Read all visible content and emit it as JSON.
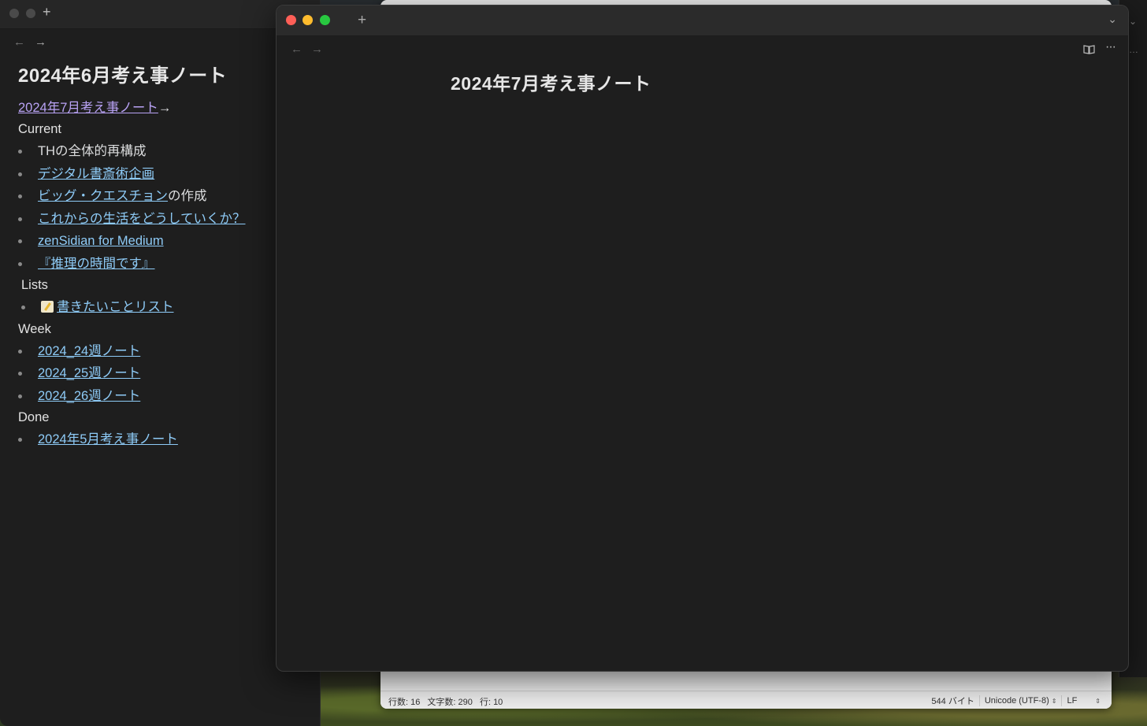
{
  "left_window": {
    "title": "2024年6月考え事ノート",
    "next_link": "2024年7月考え事ノート",
    "arrow": "→",
    "sections": {
      "current": {
        "heading": "Current",
        "items": [
          {
            "plain": "THの全体的再構成"
          },
          {
            "link": "デジタル書斎術企画"
          },
          {
            "link": "ビッグ・クエスチョン",
            "suffix": "の作成"
          },
          {
            "link": "これからの生活をどうしていくか？"
          },
          {
            "link": "zenSidian for Medium"
          },
          {
            "link": "『推理の時間です』"
          }
        ]
      },
      "lists": {
        "heading": "Lists",
        "items": [
          {
            "link": "書きたいことリスト",
            "icon": "memo-icon"
          }
        ]
      },
      "week": {
        "heading": "Week",
        "items": [
          {
            "link": "2024_24週ノート"
          },
          {
            "link": "2024_25週ノート"
          },
          {
            "link": "2024_26週ノート"
          }
        ]
      },
      "done": {
        "heading": "Done",
        "items": [
          {
            "link": "2024年5月考え事ノート"
          }
        ]
      }
    }
  },
  "front_window": {
    "title": "2024年7月考え事ノート",
    "new_tab": "+",
    "more": "···"
  },
  "editor_status": {
    "lines_label": "行数: 16",
    "chars_label": "文字数: 290",
    "row_label": "行: 10",
    "bytes": "544 バイト",
    "encoding": "Unicode (UTF-8)",
    "line_ending": "LF"
  },
  "colors": {
    "link_purple": "#b9a3f5",
    "link_blue": "#8ecbf7",
    "window_bg": "#1e1e1e",
    "close": "#fe5f57",
    "minimize": "#febc2e",
    "zoom": "#28c840"
  }
}
